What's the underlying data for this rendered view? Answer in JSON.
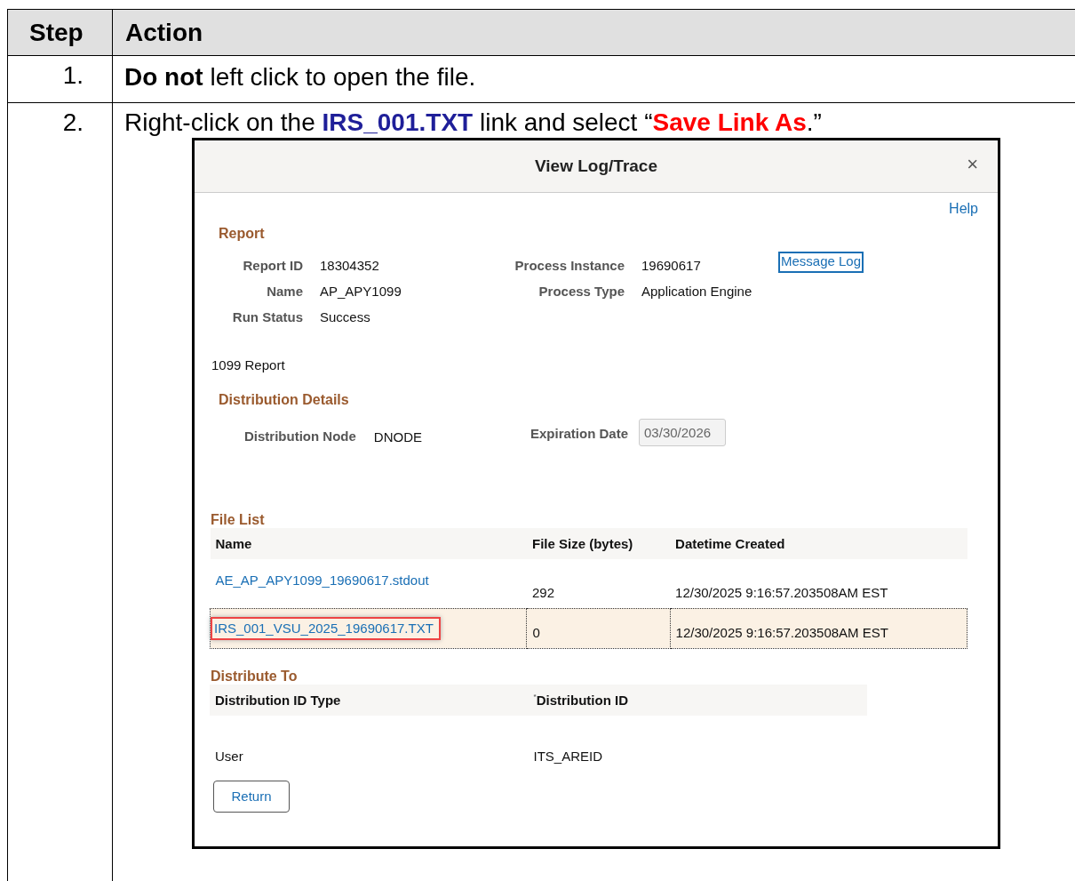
{
  "table": {
    "columns": [
      "Step",
      "Action"
    ],
    "rows": [
      {
        "step": "1.",
        "action": [
          {
            "kind": "bold",
            "text": "Do not"
          },
          {
            "kind": "plain",
            "text": " left click to open the file."
          }
        ]
      },
      {
        "step": "2.",
        "action": [
          {
            "kind": "plain",
            "text": "Right-click on the "
          },
          {
            "kind": "bold-blue",
            "text": "IRS_001.TXT"
          },
          {
            "kind": "plain",
            "text": " link and select “"
          },
          {
            "kind": "bold-red",
            "text": "Save Link As"
          },
          {
            "kind": "plain",
            "text": ".”"
          }
        ]
      }
    ]
  },
  "dialog": {
    "title": "View Log/Trace",
    "close": "×",
    "help": "Help",
    "report": {
      "heading": "Report",
      "fields": [
        {
          "label": "Report ID",
          "value": "18304352"
        },
        {
          "label": "Process Instance",
          "value": "19690617"
        },
        {
          "label": "Name",
          "value": "AP_APY1099"
        },
        {
          "label": "Process Type",
          "value": "Application Engine"
        },
        {
          "label": "Run Status",
          "value": "Success"
        }
      ],
      "message_log": "Message Log",
      "description": "1099 Report"
    },
    "distribution_details": {
      "heading": "Distribution Details",
      "node_label": "Distribution Node",
      "node_value": "DNODE",
      "expiration_label": "Expiration Date",
      "expiration_value": "03/30/2026"
    },
    "file_list": {
      "heading": "File List",
      "columns": [
        "Name",
        "File Size (bytes)",
        "Datetime Created"
      ],
      "rows": [
        {
          "name": "AE_AP_APY1099_19690617.stdout",
          "size": "292",
          "created": "12/30/2025  9:16:57.203508AM EST",
          "selected": false,
          "callout": false
        },
        {
          "name": "IRS_001_VSU_2025_19690617.TXT",
          "size": "0",
          "created": "12/30/2025  9:16:57.203508AM EST",
          "selected": true,
          "callout": true
        }
      ]
    },
    "distribute_to": {
      "heading": "Distribute To",
      "columns": [
        {
          "label": "Distribution ID Type",
          "required": false
        },
        {
          "label": "Distribution ID",
          "required": true
        }
      ],
      "required_mark": "*",
      "rows": [
        [
          "User",
          "ITS_AREID"
        ]
      ]
    },
    "return_button": "Return"
  }
}
